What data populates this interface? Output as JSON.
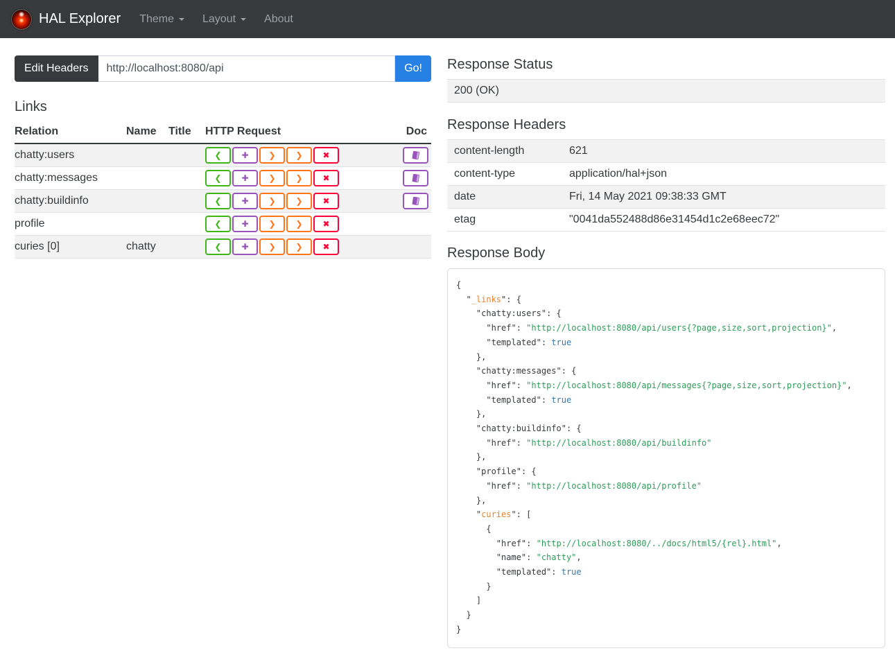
{
  "colors": {
    "primary": "#2780e3",
    "navbar_bg": "#373a3c",
    "stripe": "#f2f2f2",
    "table_border": "#dee2e6",
    "doc": "#9954bb",
    "code_punct": "#373a3c",
    "code_key": "#373a3c",
    "code_hal_key": "#e8822e",
    "code_string": "#2f9c5a",
    "code_boolean": "#3579ad"
  },
  "navbar": {
    "brand": "HAL Explorer",
    "items": [
      {
        "label": "Theme",
        "has_caret": true
      },
      {
        "label": "Layout",
        "has_caret": true
      },
      {
        "label": "About",
        "has_caret": false
      }
    ]
  },
  "request_bar": {
    "edit_headers_label": "Edit Headers",
    "url_value": "http://localhost:8080/api",
    "go_label": "Go!"
  },
  "links_section": {
    "title": "Links",
    "columns": [
      "Relation",
      "Name",
      "Title",
      "HTTP Request",
      "Doc"
    ],
    "http_buttons": [
      {
        "kind": "get",
        "glyph": "❮",
        "color": "#3fb618"
      },
      {
        "kind": "post",
        "glyph": "✚",
        "color": "#9954bb"
      },
      {
        "kind": "put",
        "glyph": "❯",
        "color": "#ff7518"
      },
      {
        "kind": "patch",
        "glyph": "❯",
        "color": "#ff7518"
      },
      {
        "kind": "delete",
        "glyph": "✖",
        "color": "#ff0039"
      }
    ],
    "rows": [
      {
        "relation": "chatty:users",
        "name": "",
        "title": "",
        "doc": true
      },
      {
        "relation": "chatty:messages",
        "name": "",
        "title": "",
        "doc": true
      },
      {
        "relation": "chatty:buildinfo",
        "name": "",
        "title": "",
        "doc": true
      },
      {
        "relation": "profile",
        "name": "",
        "title": "",
        "doc": false
      },
      {
        "relation": "curies [0]",
        "name": "chatty",
        "title": "",
        "doc": false
      }
    ]
  },
  "response_status": {
    "title": "Response Status",
    "value": "200 (OK)"
  },
  "response_headers": {
    "title": "Response Headers",
    "rows": [
      {
        "key": "content-length",
        "value": "621"
      },
      {
        "key": "content-type",
        "value": "application/hal+json"
      },
      {
        "key": "date",
        "value": "Fri, 14 May 2021 09:38:33 GMT"
      },
      {
        "key": "etag",
        "value": "\"0041da552488d86e31454d1c2e68eec72\""
      }
    ]
  },
  "response_body": {
    "title": "Response Body",
    "lines": [
      [
        {
          "t": "{",
          "c": "p"
        }
      ],
      [
        {
          "t": "  \"",
          "c": "p"
        },
        {
          "t": "_links",
          "c": "hk"
        },
        {
          "t": "\": {",
          "c": "p"
        }
      ],
      [
        {
          "t": "    ",
          "c": "p"
        },
        {
          "t": "\"chatty:users\"",
          "c": "k"
        },
        {
          "t": ": {",
          "c": "p"
        }
      ],
      [
        {
          "t": "      ",
          "c": "p"
        },
        {
          "t": "\"href\"",
          "c": "k"
        },
        {
          "t": ": ",
          "c": "p"
        },
        {
          "t": "\"http://localhost:8080/api/users{?page,size,sort,projection}\"",
          "c": "s"
        },
        {
          "t": ",",
          "c": "p"
        }
      ],
      [
        {
          "t": "      ",
          "c": "p"
        },
        {
          "t": "\"templated\"",
          "c": "k"
        },
        {
          "t": ": ",
          "c": "p"
        },
        {
          "t": "true",
          "c": "b"
        }
      ],
      [
        {
          "t": "    },",
          "c": "p"
        }
      ],
      [
        {
          "t": "    ",
          "c": "p"
        },
        {
          "t": "\"chatty:messages\"",
          "c": "k"
        },
        {
          "t": ": {",
          "c": "p"
        }
      ],
      [
        {
          "t": "      ",
          "c": "p"
        },
        {
          "t": "\"href\"",
          "c": "k"
        },
        {
          "t": ": ",
          "c": "p"
        },
        {
          "t": "\"http://localhost:8080/api/messages{?page,size,sort,projection}\"",
          "c": "s"
        },
        {
          "t": ",",
          "c": "p"
        }
      ],
      [
        {
          "t": "      ",
          "c": "p"
        },
        {
          "t": "\"templated\"",
          "c": "k"
        },
        {
          "t": ": ",
          "c": "p"
        },
        {
          "t": "true",
          "c": "b"
        }
      ],
      [
        {
          "t": "    },",
          "c": "p"
        }
      ],
      [
        {
          "t": "    ",
          "c": "p"
        },
        {
          "t": "\"chatty:buildinfo\"",
          "c": "k"
        },
        {
          "t": ": {",
          "c": "p"
        }
      ],
      [
        {
          "t": "      ",
          "c": "p"
        },
        {
          "t": "\"href\"",
          "c": "k"
        },
        {
          "t": ": ",
          "c": "p"
        },
        {
          "t": "\"http://localhost:8080/api/buildinfo\"",
          "c": "s"
        }
      ],
      [
        {
          "t": "    },",
          "c": "p"
        }
      ],
      [
        {
          "t": "    ",
          "c": "p"
        },
        {
          "t": "\"profile\"",
          "c": "k"
        },
        {
          "t": ": {",
          "c": "p"
        }
      ],
      [
        {
          "t": "      ",
          "c": "p"
        },
        {
          "t": "\"href\"",
          "c": "k"
        },
        {
          "t": ": ",
          "c": "p"
        },
        {
          "t": "\"http://localhost:8080/api/profile\"",
          "c": "s"
        }
      ],
      [
        {
          "t": "    },",
          "c": "p"
        }
      ],
      [
        {
          "t": "    \"",
          "c": "p"
        },
        {
          "t": "curies",
          "c": "hk"
        },
        {
          "t": "\": [",
          "c": "p"
        }
      ],
      [
        {
          "t": "      {",
          "c": "p"
        }
      ],
      [
        {
          "t": "        ",
          "c": "p"
        },
        {
          "t": "\"href\"",
          "c": "k"
        },
        {
          "t": ": ",
          "c": "p"
        },
        {
          "t": "\"http://localhost:8080/../docs/html5/{rel}.html\"",
          "c": "s"
        },
        {
          "t": ",",
          "c": "p"
        }
      ],
      [
        {
          "t": "        ",
          "c": "p"
        },
        {
          "t": "\"name\"",
          "c": "k"
        },
        {
          "t": ": ",
          "c": "p"
        },
        {
          "t": "\"chatty\"",
          "c": "s"
        },
        {
          "t": ",",
          "c": "p"
        }
      ],
      [
        {
          "t": "        ",
          "c": "p"
        },
        {
          "t": "\"templated\"",
          "c": "k"
        },
        {
          "t": ": ",
          "c": "p"
        },
        {
          "t": "true",
          "c": "b"
        }
      ],
      [
        {
          "t": "      }",
          "c": "p"
        }
      ],
      [
        {
          "t": "    ]",
          "c": "p"
        }
      ],
      [
        {
          "t": "  }",
          "c": "p"
        }
      ],
      [
        {
          "t": "}",
          "c": "p"
        }
      ]
    ]
  }
}
